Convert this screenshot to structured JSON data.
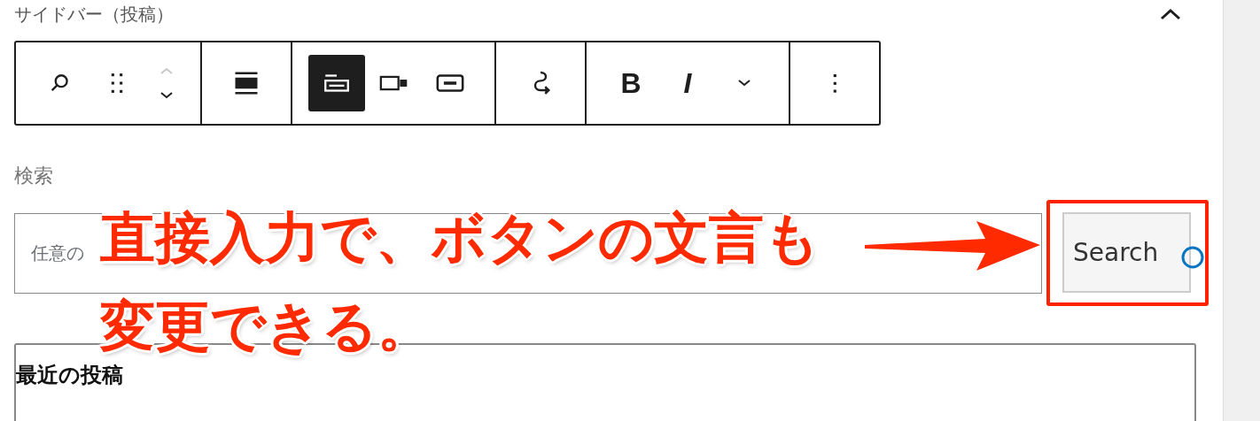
{
  "panel": {
    "title": "サイドバー（投稿）"
  },
  "toolbar": {
    "groups": [
      {
        "items": [
          {
            "kind": "search",
            "selected": false,
            "disabled": false
          },
          {
            "kind": "drag",
            "selected": false,
            "disabled": false
          },
          {
            "kind": "move-up",
            "selected": false,
            "disabled": true
          },
          {
            "kind": "move-down",
            "selected": false,
            "disabled": false
          }
        ]
      },
      {
        "items": [
          {
            "kind": "align",
            "selected": false,
            "disabled": false
          }
        ]
      },
      {
        "items": [
          {
            "kind": "button-inside",
            "selected": true,
            "disabled": false
          },
          {
            "kind": "button-outside",
            "selected": false,
            "disabled": false
          },
          {
            "kind": "button-only",
            "selected": false,
            "disabled": false
          }
        ]
      },
      {
        "items": [
          {
            "kind": "wrap",
            "selected": false,
            "disabled": false
          }
        ]
      },
      {
        "items": [
          {
            "kind": "bold",
            "label": "B",
            "selected": false,
            "disabled": false
          },
          {
            "kind": "italic",
            "label": "I",
            "selected": false,
            "disabled": false
          },
          {
            "kind": "chevron",
            "selected": false,
            "disabled": false
          }
        ]
      },
      {
        "items": [
          {
            "kind": "more",
            "selected": false,
            "disabled": false
          }
        ]
      }
    ]
  },
  "search_block": {
    "label": "検索",
    "input": {
      "placeholder": "任意の"
    },
    "button": {
      "label": "Search"
    }
  },
  "annotation": {
    "lines": [
      "直接入力で、ボタンの文言も",
      "変更できる。"
    ]
  },
  "recent_posts": {
    "heading": "最近の投稿"
  }
}
